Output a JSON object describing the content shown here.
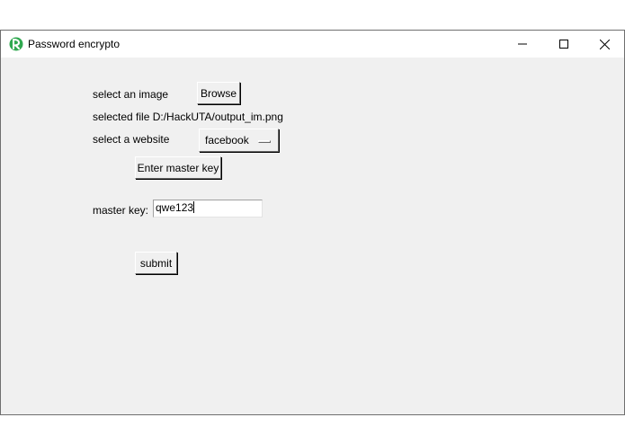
{
  "window": {
    "title": "Password encrypto",
    "icon": "tk-feather-icon",
    "controls": {
      "minimize": "minimize-icon",
      "maximize": "maximize-icon",
      "close": "close-icon"
    }
  },
  "form": {
    "select_image_label": "select an image",
    "browse_label": "Browse",
    "selected_file_text": "selected file D:/HackUTA/output_im.png",
    "select_website_label": "select a website",
    "website_selected": "facebook",
    "enter_master_key_label": "Enter master key",
    "master_key_label": "master key:",
    "master_key_value": "qwe123",
    "submit_label": "submit"
  },
  "colors": {
    "window_bg": "#f0f0f0",
    "titlebar_bg": "#ffffff",
    "icon_green": "#2fa84f"
  }
}
